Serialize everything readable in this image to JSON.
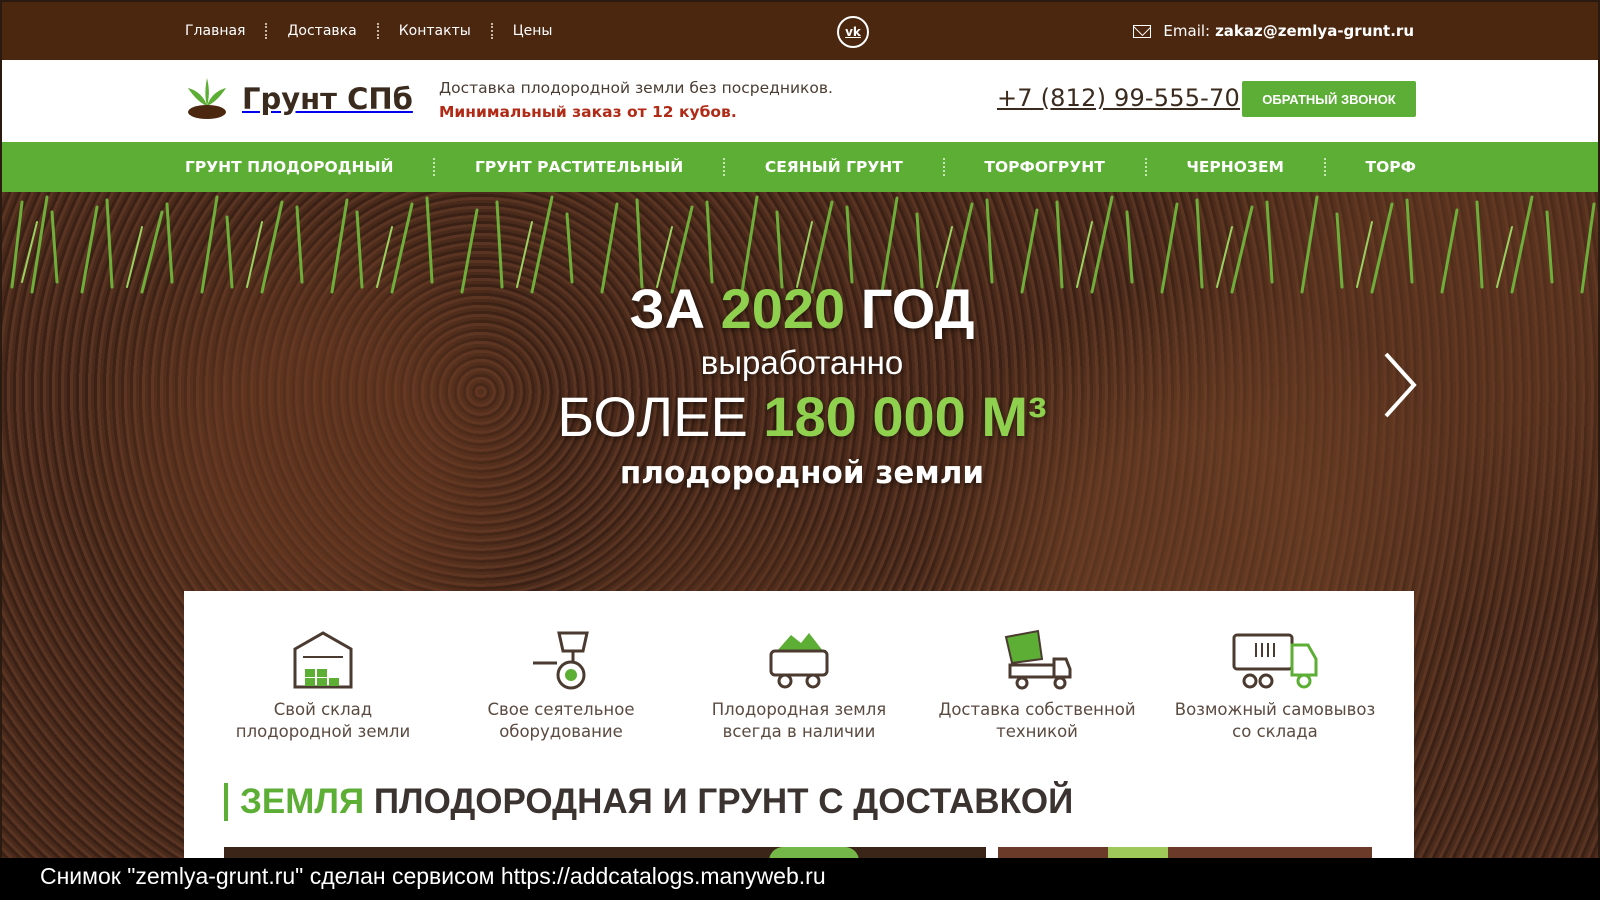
{
  "topbar": {
    "nav": [
      "Главная",
      "Доставка",
      "Контакты",
      "Цены"
    ],
    "email_label": "Email:",
    "email": "zakaz@zemlya-grunt.ru",
    "vk_icon": "vk-icon"
  },
  "header": {
    "logo_title": "Грунт СПб",
    "tagline_line1": "Доставка плодородной земли без посредников.",
    "tagline_line2": "Минимальный заказ от 12 кубов.",
    "phone": "+7 (812) 99-555-70",
    "callback_label": "ОБРАТНЫЙ ЗВОНОК"
  },
  "menu": [
    "ГРУНТ ПЛОДОРОДНЫЙ",
    "ГРУНТ РАСТИТЕЛЬНЫЙ",
    "СЕЯНЫЙ ГРУНТ",
    "ТОРФОГРУНТ",
    "ЧЕРНОЗЕМ",
    "ТОРФ"
  ],
  "hero": {
    "line1_a": "ЗА",
    "line1_year": "2020",
    "line1_b": "ГОД",
    "line2": "выработанно",
    "line3_a": "БОЛЕЕ",
    "line3_value": "180 000 М³",
    "line4": "плодородной земли"
  },
  "features": [
    {
      "icon": "warehouse-icon",
      "line1": "Свой склад",
      "line2": "плодородной земли"
    },
    {
      "icon": "seeder-icon",
      "line1": "Свое сеятельное",
      "line2": "оборудование"
    },
    {
      "icon": "soil-trailer-icon",
      "line1": "Плодородная земля",
      "line2": "всегда в наличии"
    },
    {
      "icon": "dump-truck-icon",
      "line1": "Доставка собственной",
      "line2": "техникой"
    },
    {
      "icon": "truck-icon",
      "line1": "Возможный самовывоз",
      "line2": "со склада"
    }
  ],
  "section": {
    "title_accent": "ЗЕМЛЯ",
    "title_rest": "ПЛОДОРОДНАЯ И ГРУНТ С ДОСТАВКОЙ"
  },
  "caption": "Снимок \"zemlya-grunt.ru\" сделан сервисом https://addcatalogs.manyweb.ru",
  "colors": {
    "topbar": "#4b2710",
    "accent_green": "#5cae35",
    "warning_red": "#b12a16"
  }
}
